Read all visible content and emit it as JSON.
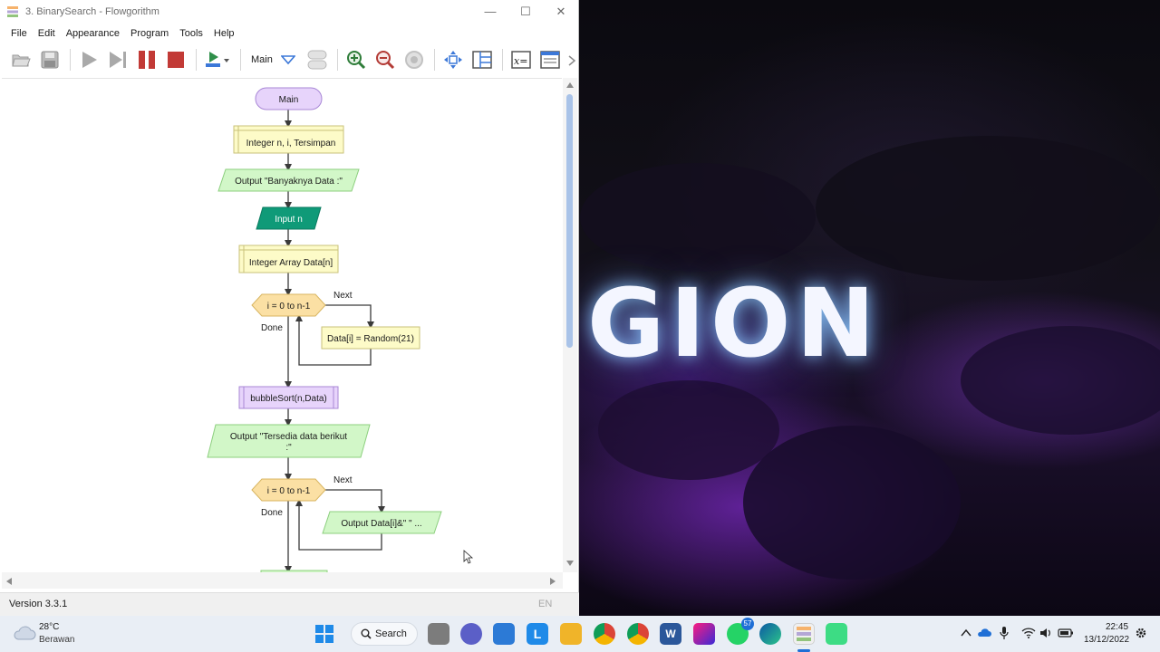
{
  "window": {
    "title": "3. BinarySearch - Flowgorithm",
    "minimize": "—",
    "maximize": "☐",
    "close": "✕"
  },
  "menu": [
    "File",
    "Edit",
    "Appearance",
    "Program",
    "Tools",
    "Help"
  ],
  "toolbar": {
    "function_selected": "Main"
  },
  "flowchart": {
    "start": "Main",
    "declare1": "Integer n, i, Tersimpan",
    "output1": "Output \"Banyaknya Data :\"",
    "input1": "Input n",
    "declare2": "Integer Array Data[n]",
    "loop1": "i = 0 to n-1",
    "loop1_next": "Next",
    "loop1_done": "Done",
    "assign1": "Data[i] = Random(21)",
    "call1": "bubbleSort(n,Data)",
    "output2_line1": "Output \"Tersedia data berikut",
    "output2_line2": ":\"",
    "loop2": "i = 0 to n-1",
    "loop2_next": "Next",
    "loop2_done": "Done",
    "output3": "Output Data[i]&\" \" ..."
  },
  "status": {
    "version": "Version 3.3.1",
    "language": "EN"
  },
  "desktop": {
    "wallpaper_text": "GION"
  },
  "taskbar": {
    "weather_temp": "28°C",
    "weather_desc": "Berawan",
    "search_label": "Search",
    "whatsapp_badge": "57",
    "time": "22:45",
    "date": "13/12/2022"
  },
  "colors": {
    "terminal": "#e7d4fb",
    "declare": "#fdfbc8",
    "output": "#d2f7c8",
    "input": "#0f9a78",
    "loop": "#fbe0a4",
    "call": "#e7d4fb"
  }
}
